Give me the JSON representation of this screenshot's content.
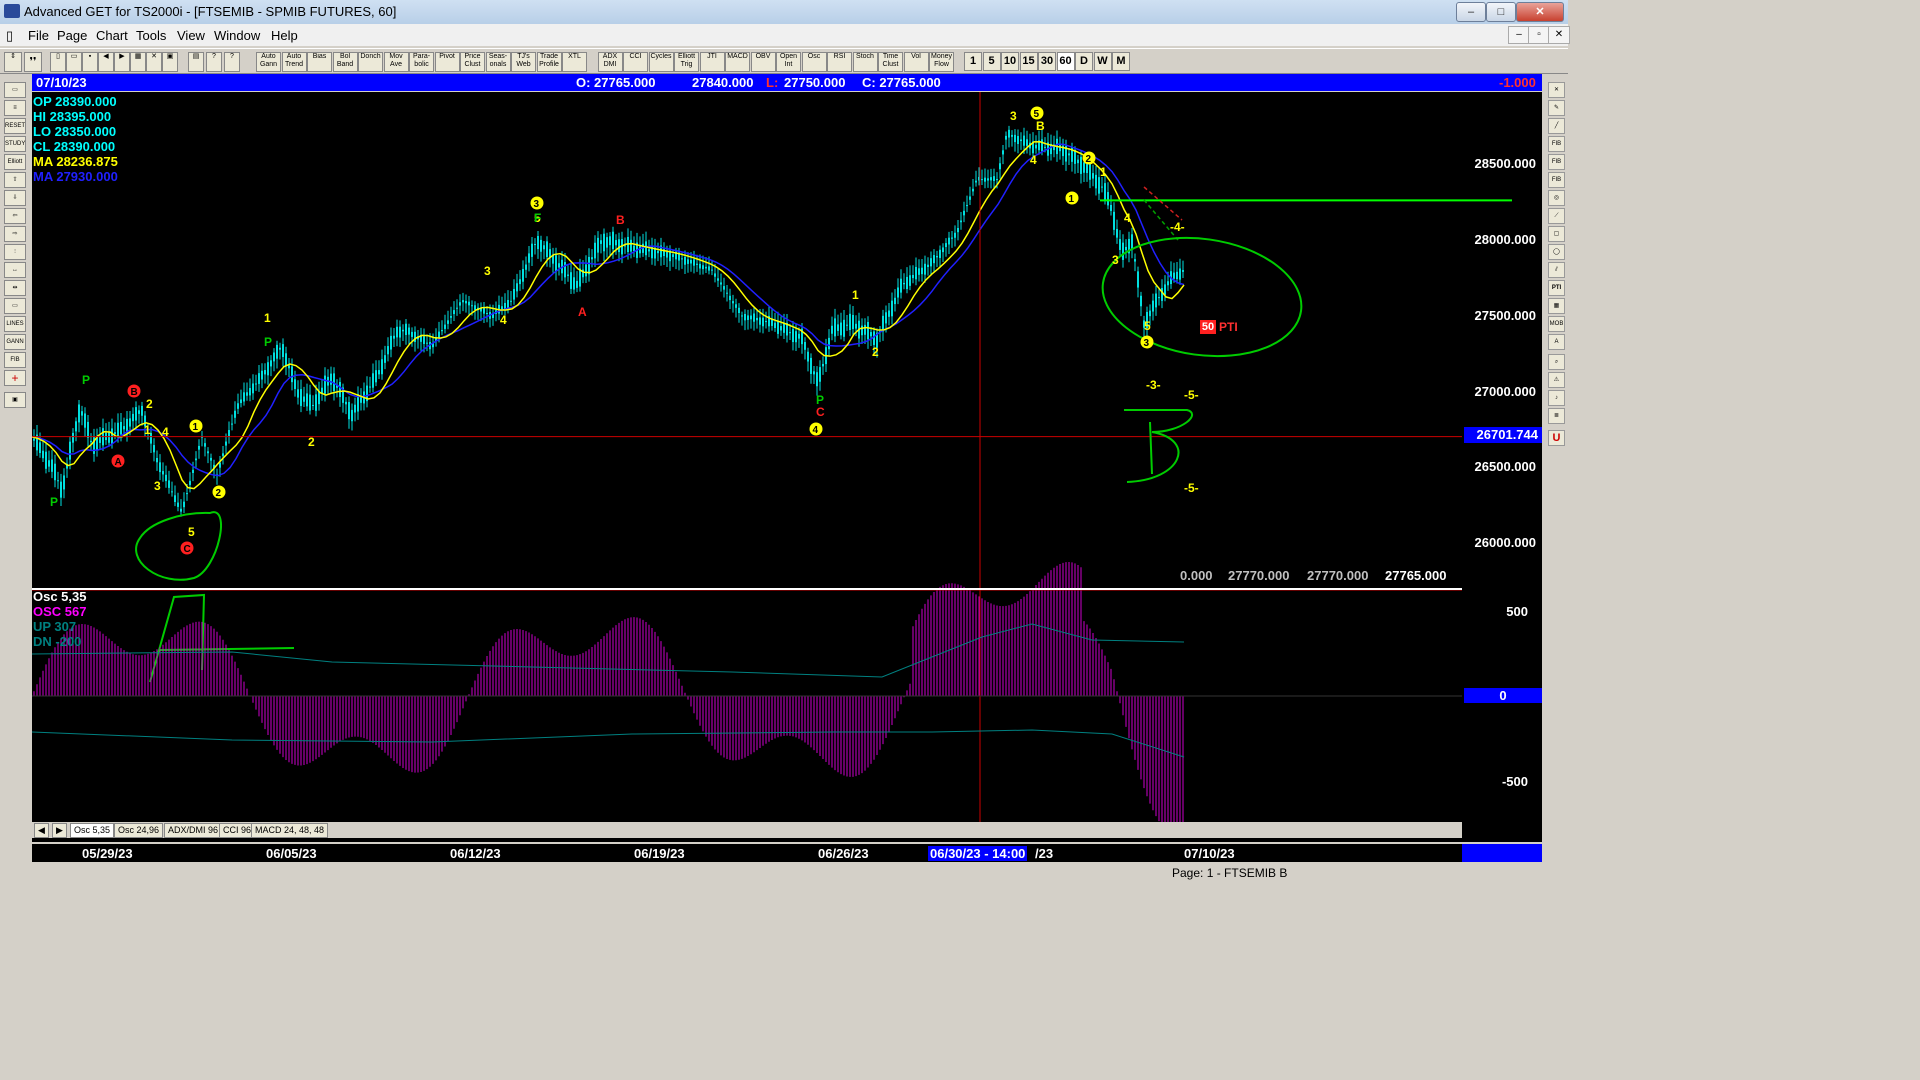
{
  "window": {
    "title": "Advanced GET for TS2000i - [FTSEMIB - SPMIB FUTURES, 60]"
  },
  "menu": [
    "File",
    "Page",
    "Chart",
    "Tools",
    "View",
    "Window",
    "Help"
  ],
  "toolbar": {
    "tools": [
      "Auto Gann",
      "Auto Trend",
      "Bias",
      "Bol Band",
      "Donch",
      "Mov Ave",
      "Para-bolic",
      "Pivot",
      "Price Clust",
      "Seas-onals",
      "TJ's Web",
      "Trade Profile",
      "XTL",
      "ADX DMI",
      "CCI",
      "Cycles",
      "Elliott Trig",
      "JTI",
      "MACD",
      "OBV",
      "Open Int",
      "Osc",
      "RSI",
      "Stoch",
      "Time Clust",
      "Vol",
      "Money Flow"
    ],
    "intervals": [
      "1",
      "5",
      "10",
      "15",
      "30",
      "60",
      "D",
      "W",
      "M"
    ]
  },
  "info_bar": {
    "date": "07/10/23",
    "open": "O: 27765.000",
    "high": "27840.000",
    "low_label": "L:",
    "low_value": "27750.000",
    "close": "C: 27765.000",
    "change": "-1.000"
  },
  "indicators": {
    "op": "OP 28390.000",
    "hi": "HI  28395.000",
    "lo": "LO  28350.000",
    "cl": "CL  28390.000",
    "ma1": "MA 28236.875",
    "ma2": "MA 27930.000"
  },
  "price_axis": {
    "labels": [
      "28500.000",
      "28000.000",
      "27500.000",
      "27000.000",
      "26500.000",
      "26000.000"
    ],
    "current": "26701.744"
  },
  "bottom_values": [
    "0.000",
    "27770.000",
    "27770.000",
    "27765.000"
  ],
  "osc_panel": {
    "title": "Osc 5,35",
    "osc": "OSC 567",
    "up": "UP   307",
    "dn": "DN   -200",
    "axis": [
      "500",
      "0",
      "-500"
    ]
  },
  "tabs": [
    "Osc 5,35",
    "Osc 24,96",
    "ADX/DMI 96",
    "CCI 96",
    "MACD 24, 48, 48"
  ],
  "dates": [
    "05/29/23",
    "06/05/23",
    "06/12/23",
    "06/19/23",
    "06/26/23",
    "06/30/23 - 14:00",
    "/23",
    "07/10/23"
  ],
  "status": "Page: 1 - FTSEMIB B",
  "annotations": {
    "pti_box": "50",
    "pti_text": "PTI",
    "m3": "-3-",
    "m5a": "-5-",
    "m5b": "-5-",
    "m4": "-4-"
  },
  "chart_data": {
    "type": "candlestick",
    "title": "FTSEMIB - SPMIB FUTURES, 60",
    "ylim": [
      25800,
      28800
    ],
    "x": [
      "05/29/23",
      "06/05/23",
      "06/12/23",
      "06/19/23",
      "06/26/23",
      "07/03/23",
      "07/10/23"
    ],
    "close_approx": [
      26900,
      27000,
      27700,
      27900,
      27400,
      28500,
      27765
    ],
    "horizontal_line_green": 28260,
    "horizontal_line_red": 26701.744,
    "osc_axis_range": [
      -700,
      650
    ],
    "series": [
      {
        "name": "MA 28236.875",
        "color": "#ffff00"
      },
      {
        "name": "MA 27930.000",
        "color": "#2020ff"
      }
    ]
  },
  "colors": {
    "bg": "#000000",
    "price": "#00e0e0",
    "ma_fast": "#ffff00",
    "ma_slow": "#2020ff",
    "osc": "#cc00cc",
    "info": "#0000ff",
    "hline": "#00ff00"
  }
}
